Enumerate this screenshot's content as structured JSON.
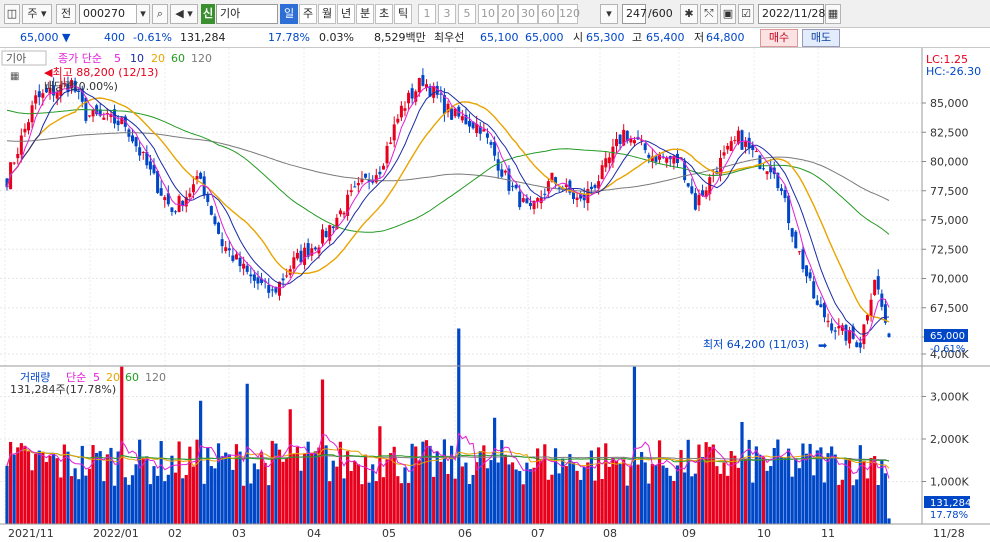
{
  "toolbar": {
    "market_label": "주",
    "prev_label": "전",
    "code": "000270",
    "code_badge": "신",
    "name": "기아",
    "period_tabs": [
      {
        "label": "일",
        "active": true
      },
      {
        "label": "주",
        "active": false
      },
      {
        "label": "월",
        "active": false
      },
      {
        "label": "년",
        "active": false
      },
      {
        "label": "분",
        "active": false
      },
      {
        "label": "초",
        "active": false
      },
      {
        "label": "틱",
        "active": false
      }
    ],
    "intervals": [
      "1",
      "3",
      "5",
      "10",
      "20",
      "30",
      "60",
      "120"
    ],
    "count": "247",
    "count_total": "/600",
    "date": "2022/11/28"
  },
  "info": {
    "price": "65,000",
    "change": "400",
    "change_pct": "-0.61%",
    "volume": "131,284",
    "turnover_pct": "17.78%",
    "rate": "0.03%",
    "amount": "8,529백만",
    "best_label": "최우선",
    "best_ask": "65,100",
    "best_bid": "65,000",
    "open_label": "시",
    "open": "65,300",
    "high_label": "고",
    "high": "65,400",
    "low_label": "저",
    "low": "64,800",
    "buy_label": "매수",
    "sell_label": "매도"
  },
  "colors": {
    "up": "#e8001c",
    "down": "#0047c8",
    "ma5": "#e21fd6",
    "ma10": "#1a2aa8",
    "ma20": "#e8a400",
    "ma60": "#239a23",
    "ma120": "#7a7a7a",
    "toolbar_bg": "#f0f0f0"
  },
  "price_panel": {
    "name": "기아",
    "legend_prefix": "종가 단순",
    "periods": [
      "5",
      "10",
      "20",
      "60",
      "120"
    ],
    "max_label": "최고 88,200 (12/13)",
    "dividend_label": "배당락(0.00%)",
    "min_label": "최저 64,200 (11/03)",
    "lc": "LC:1.25",
    "hc": "HC:-26.30",
    "current_price": "65,000",
    "current_pct": "-0.61%",
    "ticks": [
      "85,000",
      "82,500",
      "80,000",
      "77,500",
      "75,000",
      "72,500",
      "70,000",
      "67,500",
      "65,000"
    ]
  },
  "volume_panel": {
    "title": "거래량",
    "legend_prefix": "단순",
    "periods": [
      "5",
      "20",
      "60",
      "120"
    ],
    "current": "131,284주(17.78%)",
    "current_volume": "131,284",
    "current_pct": "17.78%",
    "ticks": [
      "4,000K",
      "3,000K",
      "2,000K",
      "1,000K"
    ]
  },
  "x_axis": {
    "labels": [
      "2021/11",
      "2022/01",
      "02",
      "03",
      "04",
      "05",
      "06",
      "07",
      "08",
      "09",
      "10",
      "11",
      "11/28"
    ]
  },
  "chart_data": {
    "type": "candlestick",
    "y_ticks": [
      85000,
      82500,
      80000,
      77500,
      75000,
      72500,
      70000,
      67500,
      65000
    ],
    "close_keypoints": [
      {
        "i": 0,
        "c": 78500
      },
      {
        "i": 8,
        "c": 85300
      },
      {
        "i": 18,
        "c": 86700
      },
      {
        "i": 22,
        "c": 84000
      },
      {
        "i": 33,
        "c": 83200
      },
      {
        "i": 40,
        "c": 79000
      },
      {
        "i": 46,
        "c": 75800
      },
      {
        "i": 54,
        "c": 78500
      },
      {
        "i": 60,
        "c": 73000
      },
      {
        "i": 68,
        "c": 70000
      },
      {
        "i": 74,
        "c": 68700
      },
      {
        "i": 80,
        "c": 71400
      },
      {
        "i": 88,
        "c": 73500
      },
      {
        "i": 96,
        "c": 77000
      },
      {
        "i": 104,
        "c": 79500
      },
      {
        "i": 110,
        "c": 84500
      },
      {
        "i": 116,
        "c": 87000
      },
      {
        "i": 124,
        "c": 84000
      },
      {
        "i": 132,
        "c": 83000
      },
      {
        "i": 140,
        "c": 78000
      },
      {
        "i": 146,
        "c": 75500
      },
      {
        "i": 152,
        "c": 78500
      },
      {
        "i": 160,
        "c": 76500
      },
      {
        "i": 166,
        "c": 79000
      },
      {
        "i": 172,
        "c": 82500
      },
      {
        "i": 180,
        "c": 80500
      },
      {
        "i": 188,
        "c": 80000
      },
      {
        "i": 192,
        "c": 76300
      },
      {
        "i": 198,
        "c": 79500
      },
      {
        "i": 204,
        "c": 82000
      },
      {
        "i": 210,
        "c": 80000
      },
      {
        "i": 214,
        "c": 79500
      },
      {
        "i": 220,
        "c": 73000
      },
      {
        "i": 226,
        "c": 67500
      },
      {
        "i": 232,
        "c": 65500
      },
      {
        "i": 238,
        "c": 64500
      },
      {
        "i": 242,
        "c": 70200
      },
      {
        "i": 244,
        "c": 67500
      },
      {
        "i": 246,
        "c": 65000
      }
    ],
    "volume_max": 4600000
  }
}
